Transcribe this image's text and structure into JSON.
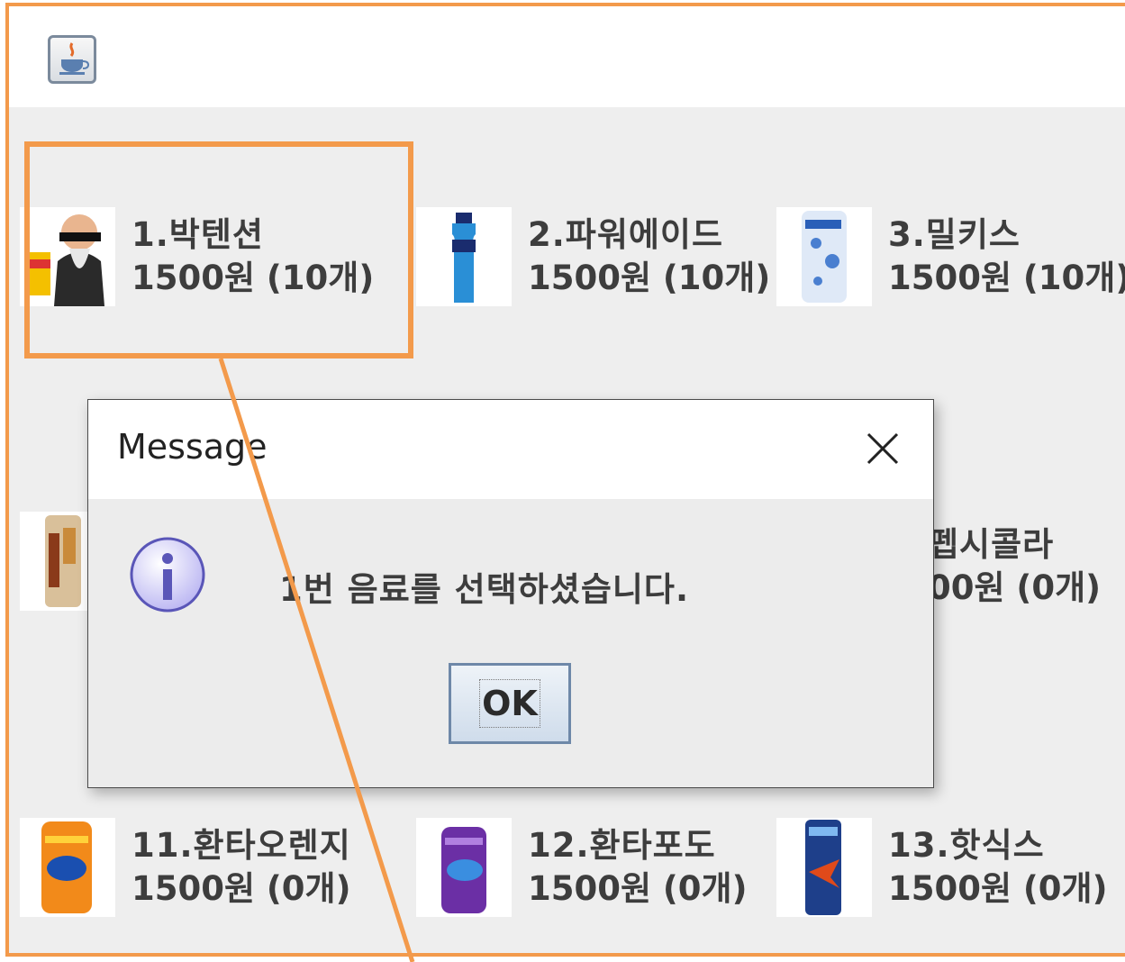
{
  "window": {
    "app_icon": "java-cup-icon"
  },
  "products": [
    {
      "name": "1.박텐션",
      "price": "1500원 (10개)",
      "icon": "bald-man-drink-icon"
    },
    {
      "name": "2.파워에이드",
      "price": "1500원 (10개)",
      "icon": "blue-bottle-icon"
    },
    {
      "name": "3.밀키스",
      "price": "1500원 (10개)",
      "icon": "milkis-can-icon"
    },
    {
      "name": "",
      "price": "",
      "icon": "canned-coffee-icon"
    },
    {
      "name": "펩시콜라",
      "price": "00원 (0개)",
      "icon": ""
    },
    {
      "name": "11.환타오렌지",
      "price": "1500원 (0개)",
      "icon": "fanta-orange-can-icon"
    },
    {
      "name": "12.환타포도",
      "price": "1500원 (0개)",
      "icon": "fanta-grape-can-icon"
    },
    {
      "name": "13.핫식스",
      "price": "1500원 (0개)",
      "icon": "hot6-can-icon"
    }
  ],
  "dialog": {
    "title": "Message",
    "message": "1번 음료를 선택하셨습니다.",
    "ok_label": "OK",
    "icon": "info-icon",
    "close_icon": "close-icon"
  },
  "colors": {
    "highlight": "#f39a4b",
    "panel_bg": "#eeeeee",
    "text": "#3d3d3d"
  }
}
